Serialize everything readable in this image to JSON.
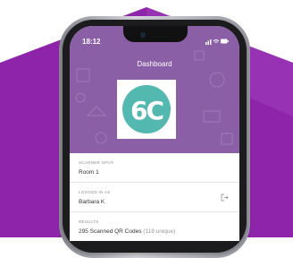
{
  "status_bar": {
    "time": "18:12"
  },
  "header": {
    "title": "Dashboard"
  },
  "logo": {
    "text": "6C",
    "color": "#52b8b0"
  },
  "fields": {
    "scanner_spot": {
      "label": "SCANNER SPOT",
      "value": "Room 1"
    },
    "logged_in_as": {
      "label": "LOGGED IN AS",
      "value": "Barbara K"
    },
    "results": {
      "label": "RESULTS",
      "value": "295 Scanned QR Codes",
      "unique": "(118 unique)"
    }
  },
  "colors": {
    "header": "#8a5fa6",
    "background_hex": "#8e24aa",
    "accent": "#52b8b0"
  },
  "icons": {
    "logout": "logout-icon",
    "signal": "signal-icon",
    "wifi": "wifi-icon",
    "battery": "battery-icon"
  }
}
